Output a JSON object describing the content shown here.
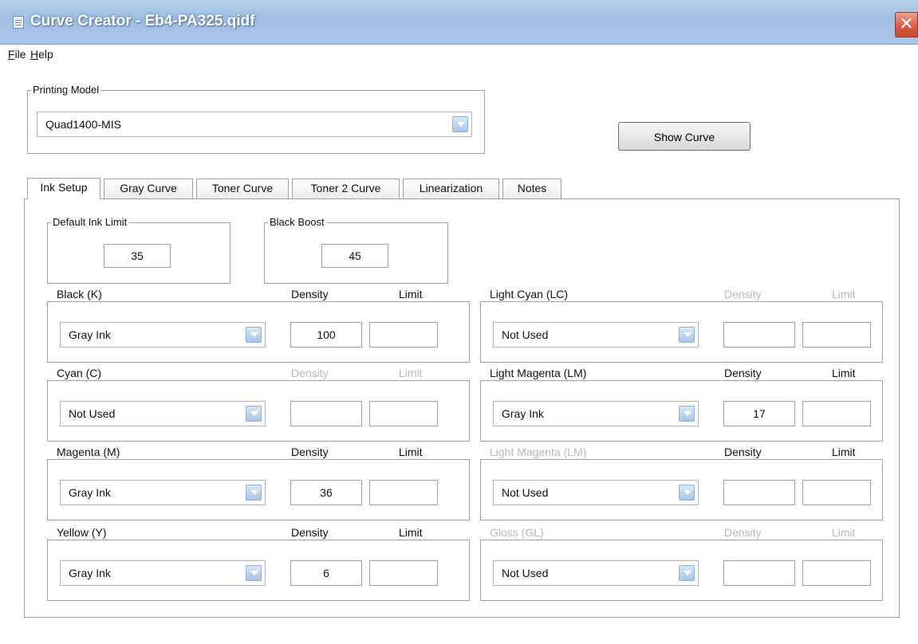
{
  "window": {
    "title": "Curve Creator - Eb4-PA325.qidf",
    "close_glyph": "✕"
  },
  "menu": {
    "file_acc": "F",
    "file_rest": "ile",
    "help_acc": "H",
    "help_rest": "elp"
  },
  "printing_model": {
    "label": "Printing Model",
    "value": "Quad1400-MIS"
  },
  "show_curve_label": "Show Curve",
  "tabs": [
    {
      "label": "Ink Setup"
    },
    {
      "label": "Gray Curve"
    },
    {
      "label": "Toner Curve"
    },
    {
      "label": "Toner 2 Curve"
    },
    {
      "label": "Linearization"
    },
    {
      "label": "Notes"
    }
  ],
  "ink_setup": {
    "default_ink_limit": {
      "label": "Default Ink Limit",
      "value": "35"
    },
    "black_boost": {
      "label": "Black Boost",
      "value": "45"
    },
    "density_header": "Density",
    "limit_header": "Limit",
    "channels": [
      {
        "name": "Black (K)",
        "ink": "Gray Ink",
        "density": "100",
        "limit": "",
        "enabled": true
      },
      {
        "name": "Cyan (C)",
        "ink": "Not Used",
        "density": "",
        "limit": "",
        "enabled": false
      },
      {
        "name": "Magenta (M)",
        "ink": "Gray Ink",
        "density": "36",
        "limit": "",
        "enabled": true
      },
      {
        "name": "Yellow (Y)",
        "ink": "Gray Ink",
        "density": "6",
        "limit": "",
        "enabled": true
      },
      {
        "name": "Light Cyan (LC)",
        "ink": "Not Used",
        "density": "",
        "limit": "",
        "enabled": false
      },
      {
        "name": "Light Magenta (LM)",
        "ink": "Gray Ink",
        "density": "17",
        "limit": "",
        "enabled": true
      },
      {
        "name": "Light Magenta (LM)",
        "ink": "Not Used",
        "density": "",
        "limit": "",
        "enabled": false,
        "name_dimmed": true,
        "headers_enabled": true
      },
      {
        "name": "Gloss (GL)",
        "ink": "Not Used",
        "density": "",
        "limit": "",
        "enabled": false,
        "name_dimmed": true
      }
    ]
  },
  "colors": {
    "titlebar": "#a9c7e8",
    "disabled_text": "#b8b8b8",
    "close_button": "#d9573e"
  },
  "icons": {
    "app": "app-icon",
    "close": "close-icon",
    "dropdown": "chevron-down-icon"
  }
}
